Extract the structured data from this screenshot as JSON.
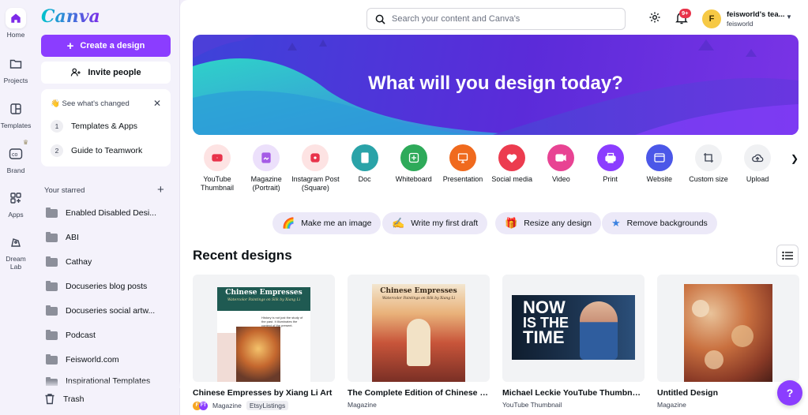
{
  "brand": {
    "logo": "Canva",
    "accent": "#8b3dff"
  },
  "rail": [
    {
      "label": "Home",
      "icon": "home-icon",
      "active": true
    },
    {
      "label": "Projects",
      "icon": "folder-icon"
    },
    {
      "label": "Templates",
      "icon": "templates-icon"
    },
    {
      "label": "Brand",
      "icon": "brand-icon"
    },
    {
      "label": "Apps",
      "icon": "apps-icon"
    },
    {
      "label": "Dream Lab",
      "icon": "dream-lab-icon"
    }
  ],
  "sidebar": {
    "create_label": "Create a design",
    "invite_label": "Invite people",
    "whats_changed": {
      "title": "See what's changed",
      "items": [
        {
          "num": "1",
          "label": "Templates & Apps"
        },
        {
          "num": "2",
          "label": "Guide to Teamwork"
        }
      ]
    },
    "starred_title": "Your starred",
    "starred": [
      "Enabled Disabled Desi...",
      "ABI",
      "Cathay",
      "Docuseries blog posts",
      "Docuseries social artw...",
      "Podcast",
      "Feisworld.com",
      "Inspirational Templates"
    ],
    "trash_label": "Trash"
  },
  "header": {
    "search_placeholder": "Search your content and Canva's",
    "notifications_badge": "9+",
    "account": {
      "initial": "F",
      "name": "feisworld's tea...",
      "sub": "feisworld"
    }
  },
  "hero": {
    "title": "What will you design today?"
  },
  "quick": [
    {
      "label": "YouTube Thumbnail",
      "icon": "youtube-icon",
      "bg": "#fde3e3",
      "fg": "#e8334a"
    },
    {
      "label": "Magazine (Portrait)",
      "icon": "magazine-icon",
      "bg": "#ece0fb",
      "fg": "#a55be6"
    },
    {
      "label": "Instagram Post (Square)",
      "icon": "instagram-icon",
      "bg": "#fde3e3",
      "fg": "#e8334a"
    },
    {
      "label": "Doc",
      "icon": "doc-icon",
      "bg": "#2aa3a8",
      "fg": "#ffffff"
    },
    {
      "label": "Whiteboard",
      "icon": "whiteboard-icon",
      "bg": "#2eaa5a",
      "fg": "#ffffff"
    },
    {
      "label": "Presentation",
      "icon": "presentation-icon",
      "bg": "#f06a1e",
      "fg": "#ffffff"
    },
    {
      "label": "Social media",
      "icon": "heart-icon",
      "bg": "#ec3c4f",
      "fg": "#ffffff"
    },
    {
      "label": "Video",
      "icon": "video-icon",
      "bg": "#e84393",
      "fg": "#ffffff"
    },
    {
      "label": "Print",
      "icon": "print-icon",
      "bg": "#8b3dff",
      "fg": "#ffffff"
    },
    {
      "label": "Website",
      "icon": "website-icon",
      "bg": "#4b57e8",
      "fg": "#ffffff"
    },
    {
      "label": "Custom size",
      "icon": "custom-size-icon",
      "bg": "#f0f1f3",
      "fg": "#3b4252"
    },
    {
      "label": "Upload",
      "icon": "upload-icon",
      "bg": "#f0f1f3",
      "fg": "#3b4252"
    }
  ],
  "pills": [
    {
      "label": "Make me an image",
      "icon": "rainbow-icon",
      "glyph": "🌈"
    },
    {
      "label": "Write my first draft",
      "icon": "magic-wand-icon",
      "glyph": "✍"
    },
    {
      "label": "Resize any design",
      "icon": "resize-icon",
      "glyph": "🎁"
    },
    {
      "label": "Remove backgrounds",
      "icon": "sparkle-icon",
      "glyph": "★"
    }
  ],
  "recent": {
    "title": "Recent designs",
    "items": [
      {
        "title": "Chinese Empresses by Xiang Li Art",
        "type": "Magazine",
        "tag": "EtsyListings",
        "thumb_heading": "Chinese Empresses",
        "thumb_sub": "Watercolor Paintings on Silk by Xiang Li",
        "thumb_body": "History is not just the study of the past. It illuminates the context of the present."
      },
      {
        "title": "The Complete Edition of Chinese E...",
        "type": "Magazine",
        "thumb_heading": "Chinese Empresses",
        "thumb_sub": "Watercolor Paintings on Silk by Xiang Li"
      },
      {
        "title": "Michael Leckie YouTube Thumbnails",
        "type": "YouTube Thumbnail",
        "thumb_text": [
          "NOW",
          "IS THE",
          "TIME"
        ]
      },
      {
        "title": "Untitled Design",
        "type": "Magazine"
      }
    ]
  },
  "help_label": "?"
}
